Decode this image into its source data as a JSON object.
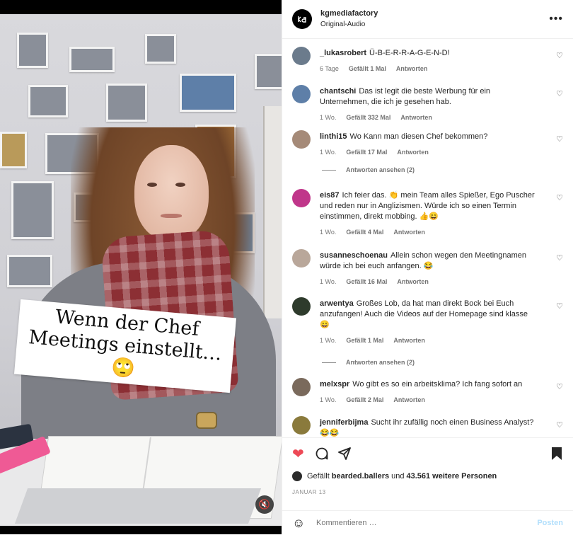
{
  "header": {
    "username": "kgmediafactory",
    "subtitle": "Original-Audio",
    "avatar_text": "k⁠g",
    "more_icon": "more-horizontal-icon"
  },
  "video": {
    "caption": "Wenn der Chef Meetings einstellt…🙄",
    "mute_icon": "🔇"
  },
  "comments": [
    {
      "user": "_lukasrobert",
      "text": "Ü-B-E-R-R-A-G-E-N-D!",
      "age": "6 Tage",
      "likes": "Gefällt 1 Mal",
      "reply": "Antworten",
      "avatar_color": "#6b7b8c"
    },
    {
      "user": "chantschi",
      "text": "Das ist legit die beste Werbung für ein Unternehmen, die ich je gesehen hab.",
      "age": "1 Wo.",
      "likes": "Gefällt 332 Mal",
      "reply": "Antworten",
      "avatar_color": "#5e7fa8"
    },
    {
      "user": "linthi15",
      "text": "Wo Kann man diesen Chef bekommen?",
      "age": "1 Wo.",
      "likes": "Gefällt 17 Mal",
      "reply": "Antworten",
      "avatar_color": "#a58a78",
      "view_replies": "Antworten ansehen (2)"
    },
    {
      "user": "eis87",
      "text": "Ich feier das. 👏 mein Team alles Spießer, Ego Puscher und reden nur in Anglizismen. Würde ich so einen Termin einstimmen, direkt mobbing. 👍😄",
      "age": "1 Wo.",
      "likes": "Gefällt 4 Mal",
      "reply": "Antworten",
      "avatar_color": "#c0368a"
    },
    {
      "user": "susanneschoenau",
      "text": "Allein schon wegen den Meetingnamen würde ich bei euch anfangen. 😂",
      "age": "1 Wo.",
      "likes": "Gefällt 16 Mal",
      "reply": "Antworten",
      "avatar_color": "#b9a79a"
    },
    {
      "user": "arwentya",
      "text": "Großes Lob, da hat man direkt Bock bei Euch anzufangen! Auch die Videos auf der Homepage sind klasse 😄",
      "age": "1 Wo.",
      "likes": "Gefällt 1 Mal",
      "reply": "Antworten",
      "avatar_color": "#2e3b2c",
      "view_replies": "Antworten ansehen (2)"
    },
    {
      "user": "melxspr",
      "text": "Wo gibt es so ein arbeitsklima? Ich fang sofort an",
      "age": "1 Wo.",
      "likes": "Gefällt 2 Mal",
      "reply": "Antworten",
      "avatar_color": "#7a6a5c"
    },
    {
      "user": "jenniferbijma",
      "text": "Sucht ihr zufällig noch einen Business Analyst? 😂😂",
      "age": "",
      "likes": "",
      "reply": "",
      "avatar_color": "#8a7a3c"
    }
  ],
  "actions": {
    "like_icon": "❤",
    "comment_icon": "◯",
    "share_icon": "➤",
    "save_icon": "bookmark-icon",
    "liked_by_prefix": "Gefällt",
    "liked_by_user": "bearded.ballers",
    "liked_by_suffix_and": "und",
    "liked_by_count": "43.561 weitere Personen",
    "date": "JANUAR 13",
    "comment_placeholder": "Kommentieren …",
    "post_label": "Posten"
  },
  "colors": {
    "like_red": "#ed4956",
    "post_blue": "#b2dffc",
    "meta_gray": "#737373"
  }
}
